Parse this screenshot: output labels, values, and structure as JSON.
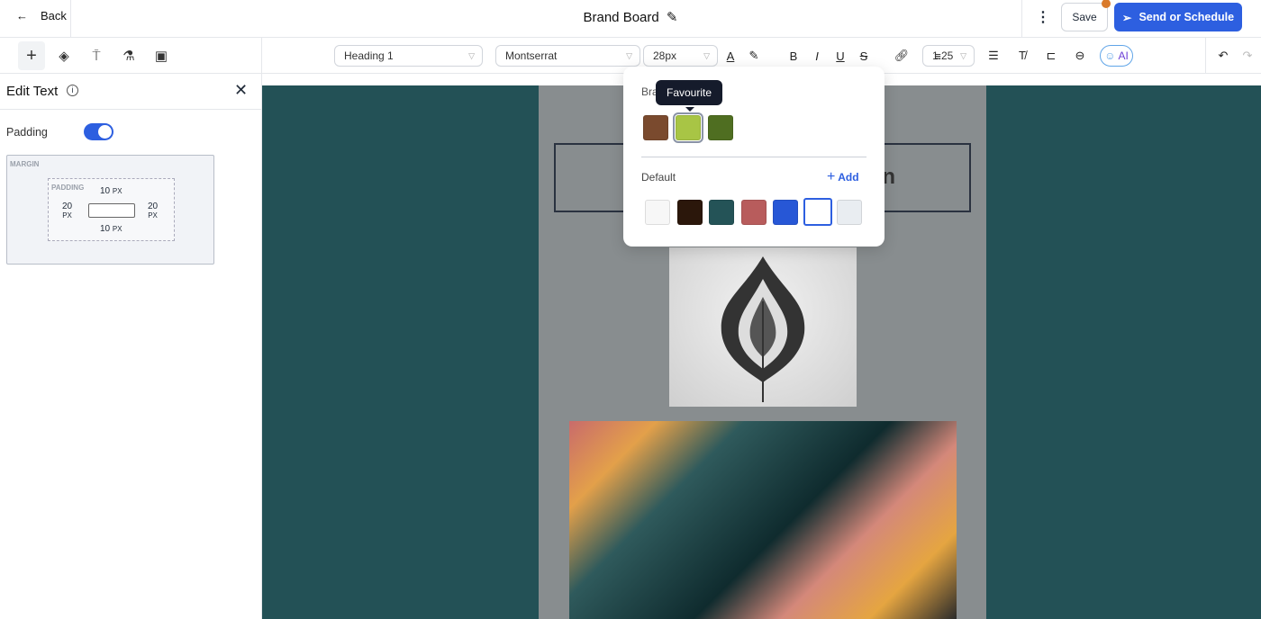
{
  "header": {
    "back_label": "Back",
    "title": "Brand Board",
    "save_label": "Save",
    "send_label": "Send or Schedule"
  },
  "toolbar": {
    "block_type": "Heading 1",
    "font": "Montserrat",
    "font_size": "28px",
    "line_height": "1.25",
    "ai_label": "AI"
  },
  "panel": {
    "title": "Edit Text",
    "padding_label": "Padding",
    "padding_enabled": true,
    "margin_label": "MARGIN",
    "padding_box_label": "PADDING",
    "top": "10",
    "bottom": "10",
    "left": "20",
    "right": "20",
    "unit": "PX"
  },
  "popover": {
    "brand_label": "Bra",
    "tooltip": "Favourite",
    "default_label": "Default",
    "add_label": "Add",
    "brand_colors": [
      "#7a4a2e",
      "#a8c545",
      "#4f6e21"
    ],
    "default_colors": [
      "#f7f7f7",
      "#2b170b",
      "#245357",
      "#b85c5c",
      "#2757d6",
      "#ffffff",
      "#e9edf1"
    ]
  },
  "canvas": {
    "heading_fragment": "n"
  },
  "colors": {
    "accent": "#2d5fe0",
    "canvas_bg": "#235156"
  }
}
